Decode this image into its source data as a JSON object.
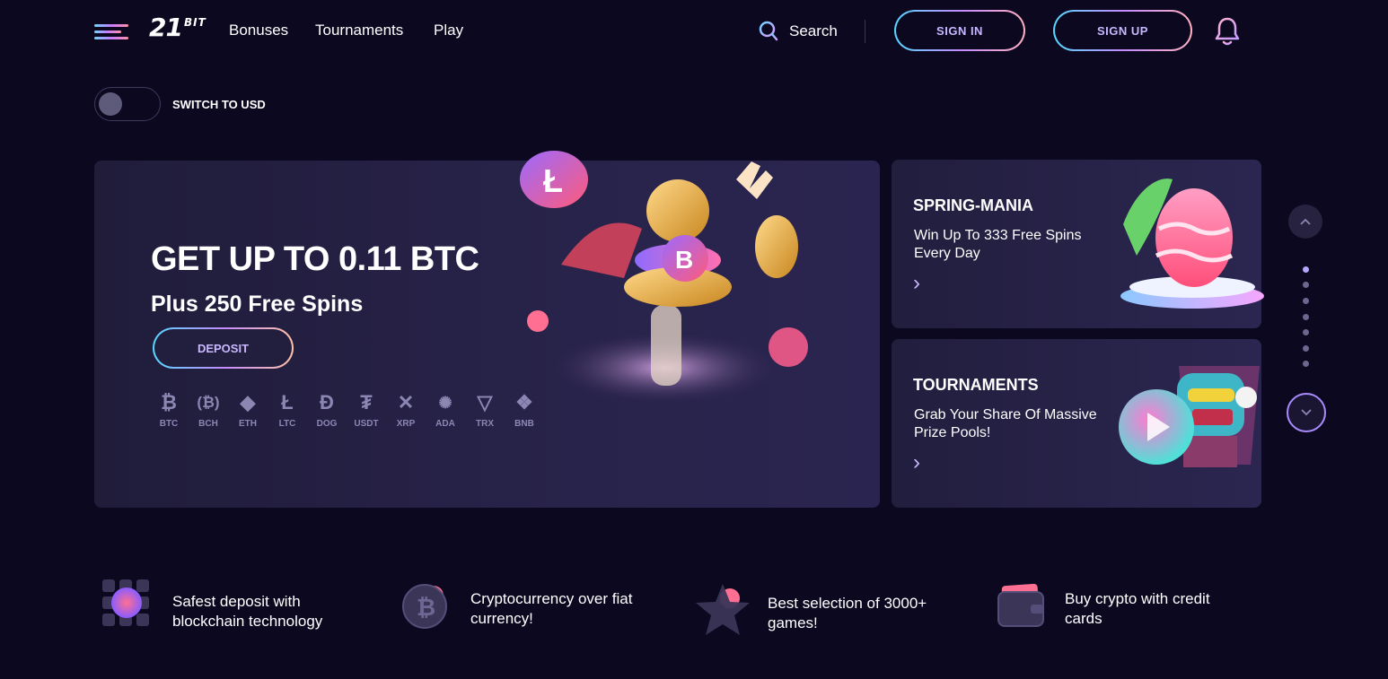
{
  "header": {
    "logo_main": "21",
    "logo_suffix": "BIT",
    "nav": [
      "Bonuses",
      "Tournaments",
      "Play"
    ],
    "search_label": "Search",
    "sign_in": "SIGN IN",
    "sign_up": "SIGN UP"
  },
  "currency_switch": {
    "label": "SWITCH TO USD",
    "on": false
  },
  "hero": {
    "title": "GET UP TO 0.11 BTC",
    "subtitle": "Plus 250 Free Spins",
    "deposit_label": "DEPOSIT",
    "coins": [
      "BTC",
      "BCH",
      "ETH",
      "LTC",
      "DOG",
      "USDT",
      "XRP",
      "ADA",
      "TRX",
      "BNB"
    ]
  },
  "cards": [
    {
      "title": "SPRING-MANIA",
      "text": "Win Up To 333 Free Spins Every Day"
    },
    {
      "title": "TOURNAMENTS",
      "text": "Grab Your Share Of Massive Prize Pools!"
    }
  ],
  "slider": {
    "total": 7,
    "active_index": 0
  },
  "features": [
    {
      "text": "Safest deposit with blockchain technology",
      "icon": "blockchain-grid-icon"
    },
    {
      "text": "Cryptocurrency over fiat currency!",
      "icon": "bitcoin-coin-icon"
    },
    {
      "text": "Best selection of 3000+ games!",
      "icon": "star-icon"
    },
    {
      "text": "Buy crypto with credit cards",
      "icon": "wallet-icon"
    }
  ],
  "colors": {
    "background": "#0b0820",
    "card": "#221e3e",
    "accent": "#c9b8ff"
  }
}
